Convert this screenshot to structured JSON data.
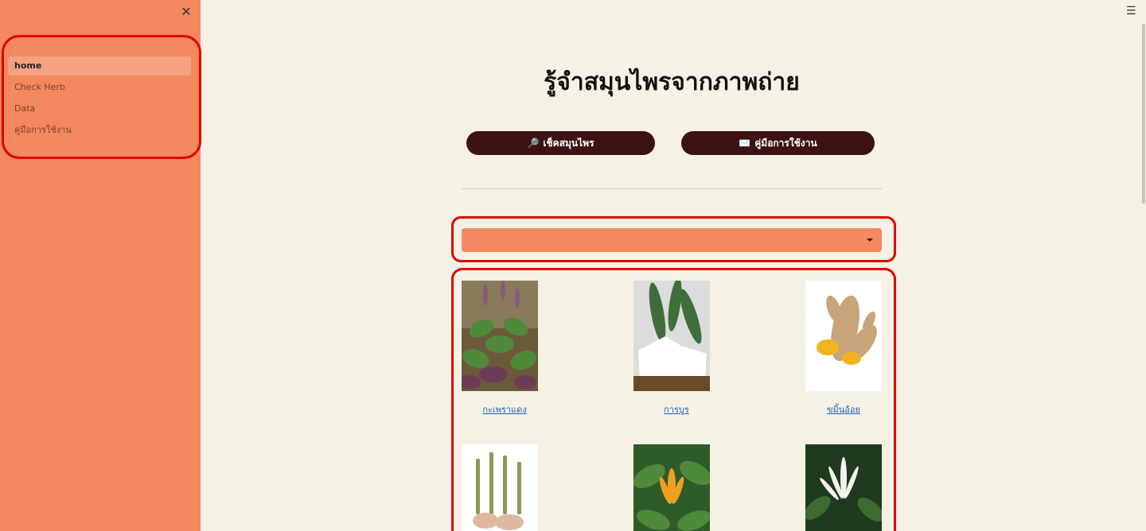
{
  "sidebar": {
    "close_icon": "close-icon",
    "items": [
      {
        "label": "home",
        "active": true
      },
      {
        "label": "Check Herb",
        "active": false
      },
      {
        "label": "Data",
        "active": false
      },
      {
        "label": "คู่มือการใช้งาน",
        "active": false
      }
    ]
  },
  "header": {
    "menu_icon": "hamburger-menu-icon"
  },
  "main": {
    "title": "รู้จำสมุนไพรจากภาพถ่าย",
    "buttons": {
      "check": {
        "icon": "🔎",
        "label": "เช็คสมุนไพร"
      },
      "manual": {
        "icon": "✉️",
        "label": "คู่มือการใช้งาน"
      }
    },
    "select": {
      "value": ""
    },
    "herbs": [
      {
        "name": "กะเพราแดง",
        "image": "red-holy-basil-image"
      },
      {
        "name": "การบูร",
        "image": "camphor-image"
      },
      {
        "name": "ขมิ้นอ้อย",
        "image": "zedoary-image"
      },
      {
        "name": "",
        "image": "fingerroot-image"
      },
      {
        "name": "",
        "image": "champak-flower-image"
      },
      {
        "name": "",
        "image": "white-champaca-image"
      }
    ]
  },
  "colors": {
    "background": "#f5f1e4",
    "sidebar": "#f4885f",
    "button": "#3d1212",
    "link": "#1f5fbf",
    "highlight_border": "#e00000"
  }
}
